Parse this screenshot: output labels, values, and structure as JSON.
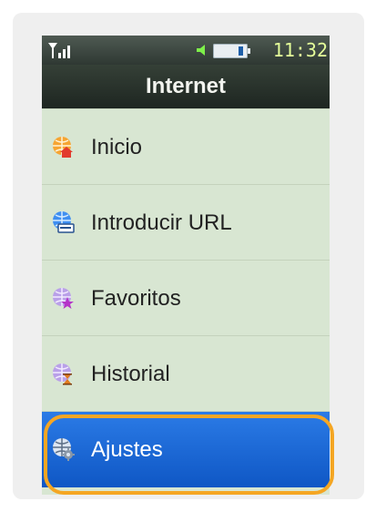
{
  "status": {
    "time": "11:32",
    "icons": [
      "signal-icon",
      "speaker-icon",
      "battery-icon"
    ]
  },
  "header": {
    "title": "Internet"
  },
  "menu": {
    "items": [
      {
        "label": "Inicio",
        "icon": "home-globe-icon"
      },
      {
        "label": "Introducir URL",
        "icon": "url-globe-icon"
      },
      {
        "label": "Favoritos",
        "icon": "favorites-globe-icon"
      },
      {
        "label": "Historial",
        "icon": "history-globe-icon"
      },
      {
        "label": "Ajustes",
        "icon": "settings-globe-icon",
        "selected": true
      }
    ]
  },
  "colors": {
    "accent": "#0f57c5",
    "highlight": "#f5a623",
    "menu_background": "#d8e6d2"
  }
}
